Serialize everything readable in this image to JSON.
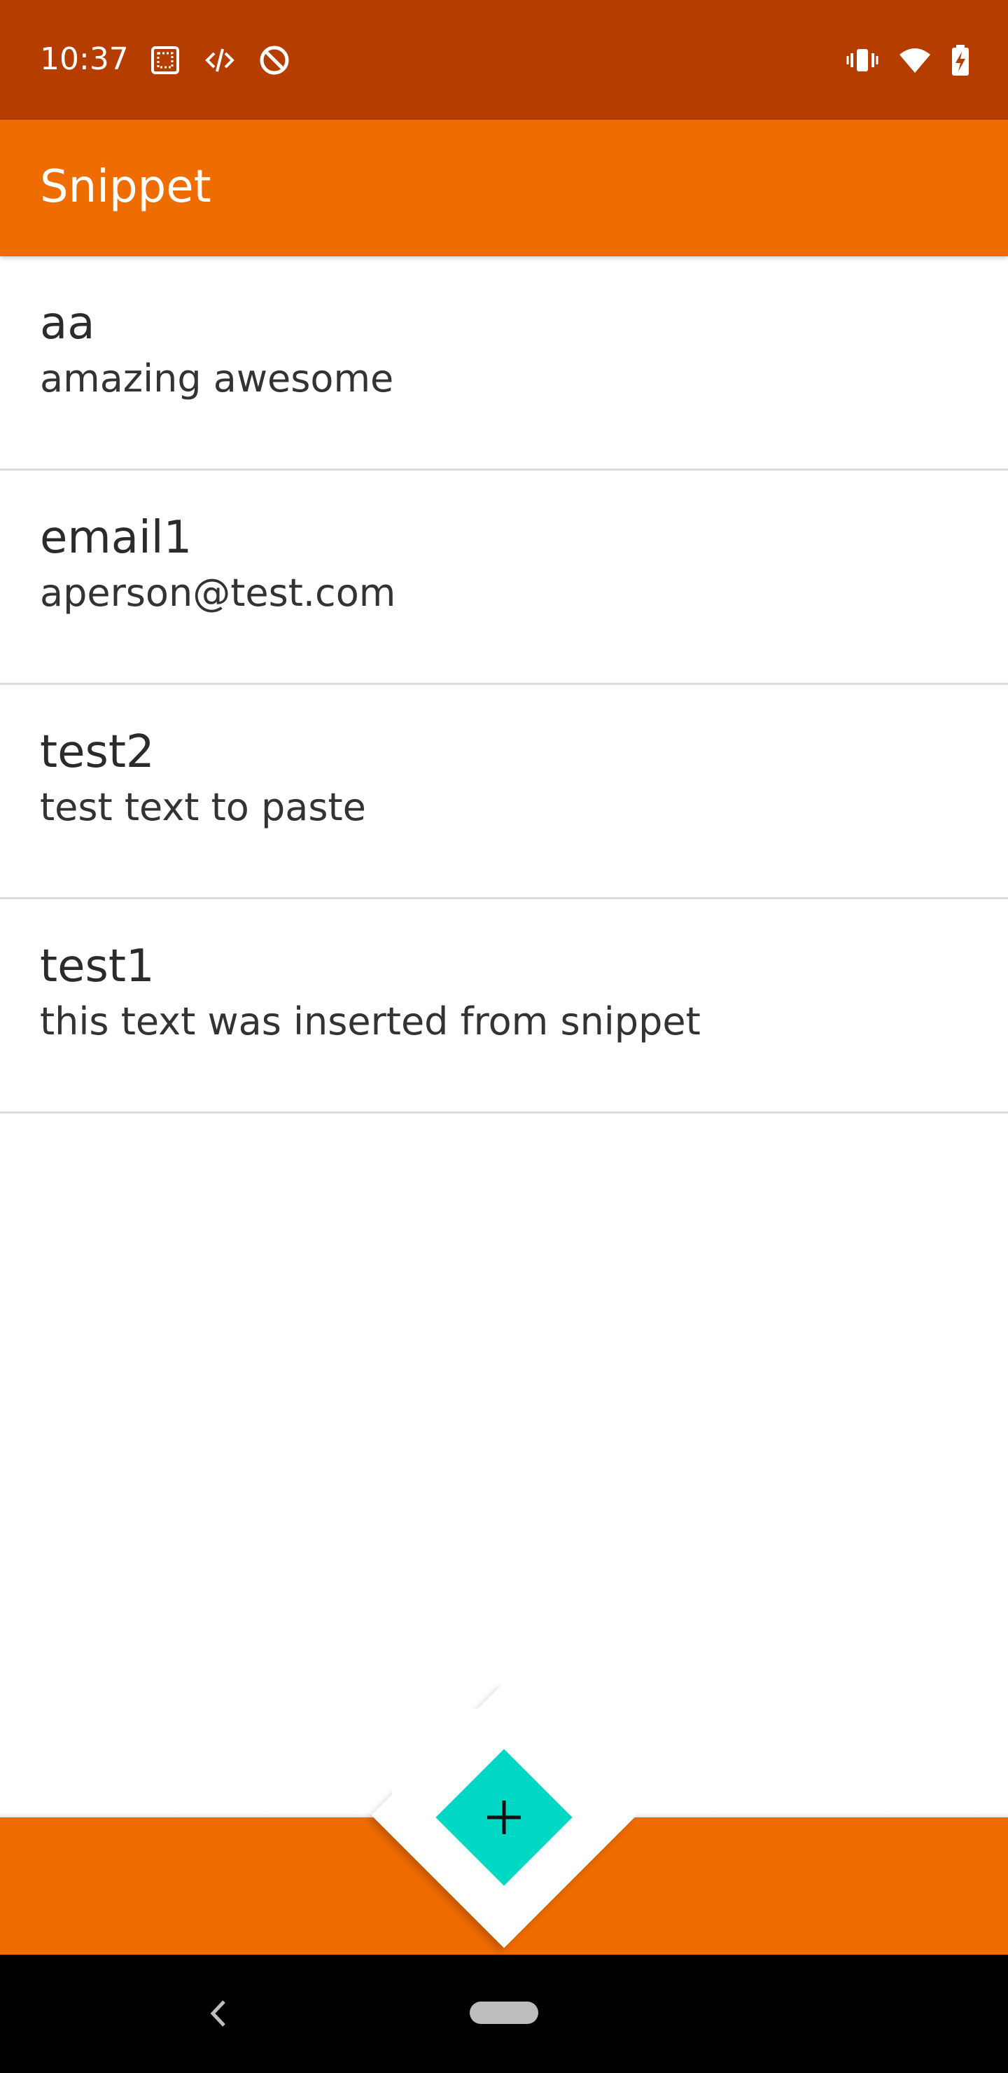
{
  "status_bar": {
    "time": "10:37",
    "left_icons": [
      "screenshot-icon",
      "dev-tools-icon",
      "no-disturb-icon"
    ],
    "right_icons": [
      "vibrate-icon",
      "wifi-icon",
      "battery-charging-icon"
    ]
  },
  "app_bar": {
    "title": "Snippet"
  },
  "snippets": [
    {
      "title": "aa",
      "text": "amazing awesome"
    },
    {
      "title": "email1",
      "text": "aperson@test.com"
    },
    {
      "title": "test2",
      "text": "test text to paste"
    },
    {
      "title": "test1",
      "text": "this text was inserted from snippet"
    }
  ],
  "fab": {
    "icon": "plus-icon"
  },
  "navigation": {
    "back_icon": "back-chevron-icon",
    "home_icon": "home-pill-icon"
  },
  "colors": {
    "status_bar": "#b53d00",
    "app_bar": "#ef6c00",
    "fab": "#00d7c5",
    "nav_bar": "#000000"
  }
}
